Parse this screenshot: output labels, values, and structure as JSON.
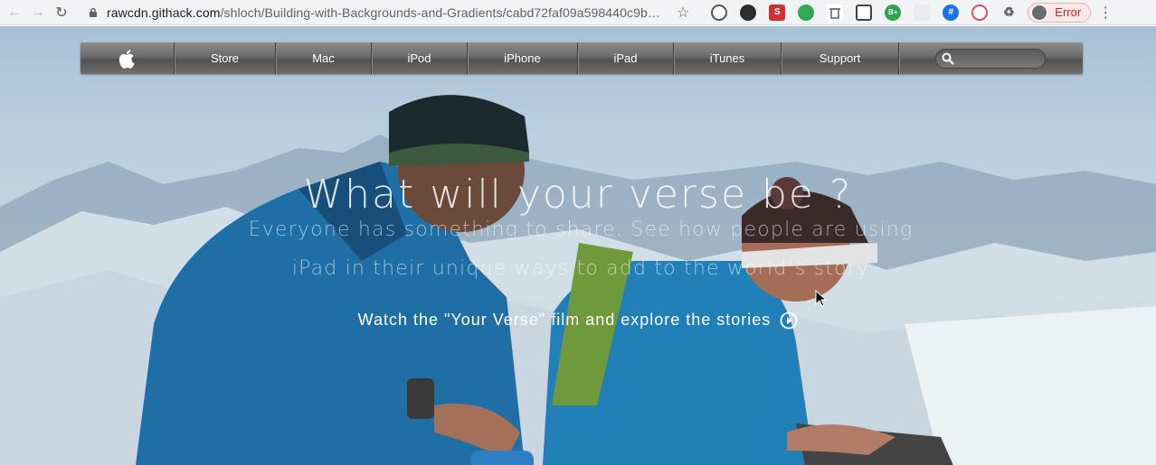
{
  "browser": {
    "url_host": "rawcdn.githack.com",
    "url_path": "/shloch/Building-with-Backgrounds-and-Gradients/cabd72faf09a598440c9b…",
    "error_label": "Error"
  },
  "nav": {
    "items": [
      "Store",
      "Mac",
      "iPod",
      "iPhone",
      "iPad",
      "iTunes",
      "Support"
    ]
  },
  "hero": {
    "headline": "What will your verse be ?",
    "subline_1": "Everyone has something to share. See how people are using",
    "subline_2": "iPad in their unique ways to add to the world’s story",
    "cta": "Watch the \"Your Verse\" film and explore the stories"
  },
  "colors": {
    "nav_bar": "#6a6a6a",
    "jacket_blue": "#1f6fa6",
    "sky": "#b9cfdf"
  }
}
